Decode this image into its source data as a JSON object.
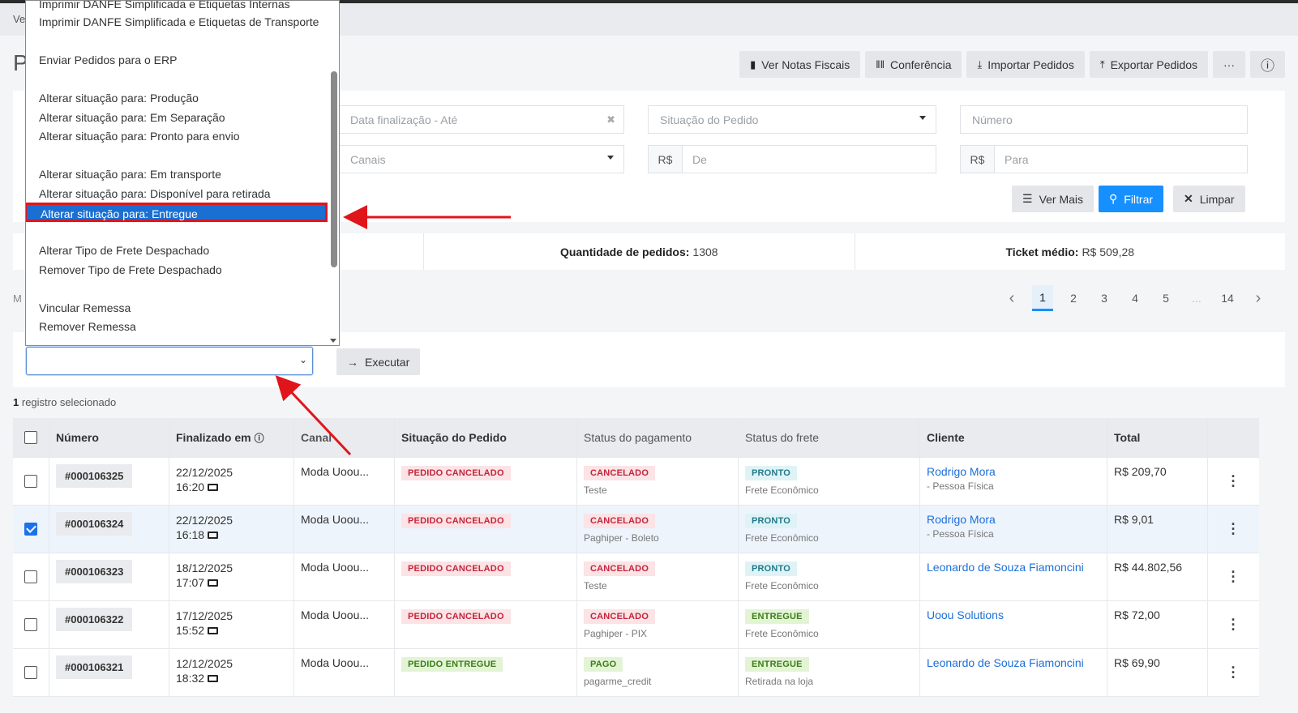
{
  "breadcrumb": "Ve",
  "page_title": "P",
  "toolbar": [
    {
      "label": "Ver Notas Fiscais",
      "icon": "file-icon"
    },
    {
      "label": "Conferência",
      "icon": "barcode-icon"
    },
    {
      "label": "Importar Pedidos",
      "icon": "import-icon"
    },
    {
      "label": "Exportar Pedidos",
      "icon": "export-icon"
    },
    {
      "label": "···",
      "icon": "more-icon"
    },
    {
      "label": "ⓘ",
      "icon": "info-icon"
    }
  ],
  "filters": {
    "date_end_placeholder": "Data finalização - Até",
    "status_placeholder": "Situação do Pedido",
    "number_placeholder": "Número",
    "channels_placeholder": "Canais",
    "currency": "R$",
    "from_placeholder": "De",
    "to_placeholder": "Para",
    "more_label": "Ver Mais",
    "filter_label": "Filtrar",
    "clear_label": "Limpar"
  },
  "summary": {
    "orders_label": "Quantidade de pedidos:",
    "orders_value": "1308",
    "ticket_label": "Ticket médio:",
    "ticket_value": "R$ 509,28"
  },
  "side_partial": "M",
  "pagination": {
    "pages": [
      "1",
      "2",
      "3",
      "4",
      "5",
      "...",
      "14"
    ],
    "current": "1"
  },
  "action": {
    "execute_label": "Executar"
  },
  "selected": {
    "count": "1",
    "text": "registro selecionado"
  },
  "dropdown": {
    "items": [
      "Imprimir DANFE Simplificada e Etiquetas Internas",
      "Imprimir DANFE Simplificada e Etiquetas de Transporte",
      "Enviar Pedidos para o ERP",
      "Alterar situação para: Produção",
      "Alterar situação para: Em Separação",
      "Alterar situação para: Pronto para envio",
      "Alterar situação para: Em transporte",
      "Alterar situação para: Disponível para retirada",
      "Alterar situação para: Entregue",
      "Alterar Tipo de Frete Despachado",
      "Remover Tipo de Frete Despachado",
      "Vincular Remessa",
      "Remover Remessa"
    ],
    "highlighted": "Alterar situação para: Entregue"
  },
  "table": {
    "headers": [
      "Número",
      "Finalizado em",
      "Canal",
      "Situação do Pedido",
      "Status do pagamento",
      "Status do frete",
      "Cliente",
      "Total"
    ],
    "rows": [
      {
        "number": "#000106325",
        "date": "22/12/2025",
        "time": "16:20",
        "channel": "Moda Uoou...",
        "status": "PEDIDO CANCELADO",
        "payment": "CANCELADO",
        "payment_sub": "Teste",
        "shipping": "PRONTO",
        "shipping_sub": "Frete Econômico",
        "client": "Rodrigo Mora",
        "client_sub": "- Pessoa Física",
        "total": "R$ 209,70",
        "checked": false
      },
      {
        "number": "#000106324",
        "date": "22/12/2025",
        "time": "16:18",
        "channel": "Moda Uoou...",
        "status": "PEDIDO CANCELADO",
        "payment": "CANCELADO",
        "payment_sub": "Paghiper - Boleto",
        "shipping": "PRONTO",
        "shipping_sub": "Frete Econômico",
        "client": "Rodrigo Mora",
        "client_sub": "- Pessoa Física",
        "total": "R$ 9,01",
        "checked": true
      },
      {
        "number": "#000106323",
        "date": "18/12/2025",
        "time": "17:07",
        "channel": "Moda Uoou...",
        "status": "PEDIDO CANCELADO",
        "payment": "CANCELADO",
        "payment_sub": "Teste",
        "shipping": "PRONTO",
        "shipping_sub": "Frete Econômico",
        "client": "Leonardo de Souza Fiamoncini",
        "client_sub": "",
        "total": "R$ 44.802,56",
        "checked": false
      },
      {
        "number": "#000106322",
        "date": "17/12/2025",
        "time": "15:52",
        "channel": "Moda Uoou...",
        "status": "PEDIDO CANCELADO",
        "payment": "CANCELADO",
        "payment_sub": "Paghiper - PIX",
        "shipping": "ENTREGUE",
        "shipping_sub": "Frete Econômico",
        "client": "Uoou Solutions",
        "client_sub": "",
        "total": "R$ 72,00",
        "checked": false
      },
      {
        "number": "#000106321",
        "date": "12/12/2025",
        "time": "18:32",
        "channel": "Moda Uoou...",
        "status": "PEDIDO ENTREGUE",
        "payment": "PAGO",
        "payment_sub": "pagarme_credit",
        "shipping": "ENTREGUE",
        "shipping_sub": "Retirada na loja",
        "client": "Leonardo de Souza Fiamoncini",
        "client_sub": "",
        "total": "R$ 69,90",
        "checked": false
      }
    ]
  },
  "colors": {
    "accent": "#1790ff",
    "highlight": "#1a6fd3",
    "annotation": "#e0151b"
  }
}
